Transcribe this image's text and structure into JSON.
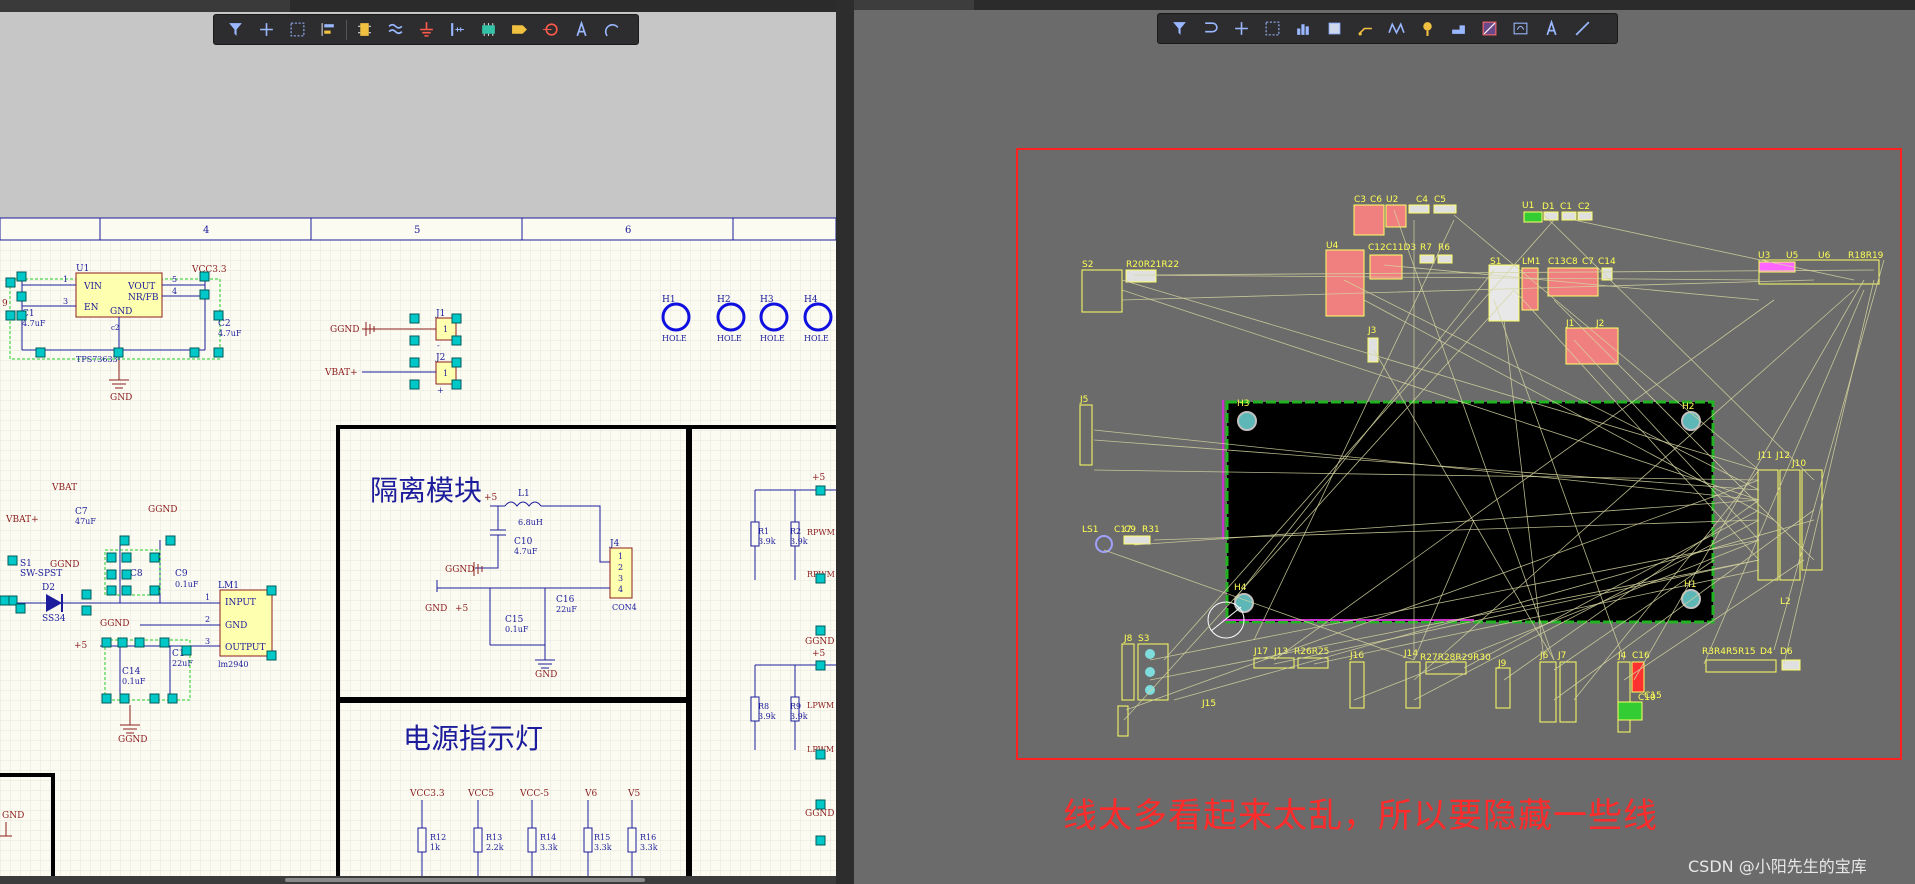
{
  "schematic": {
    "grid_columns": [
      "4",
      "5",
      "6"
    ],
    "power_block": {
      "ic_ref": "U1",
      "ic_part": "TPS73633",
      "pins": [
        "VIN",
        "EN",
        "VOUT",
        "NR/FB",
        "GND"
      ],
      "pin_numbers": [
        "1",
        "3",
        "5",
        "4",
        "c2"
      ],
      "cap1_ref": "C1",
      "cap1_val": "4.7uF",
      "cap2_ref": "C2",
      "cap2_val": "4.7uF",
      "net_vcc": "VCC3.3",
      "net_gnd": "GND",
      "left_fragment": "9"
    },
    "connectors": {
      "j1": "J1",
      "j2": "J2",
      "pin": "1",
      "j1_net": "GGND",
      "j2_net": "VBAT+",
      "minus": "-",
      "plus": "+"
    },
    "holes": [
      {
        "ref": "H1",
        "label": "HOLE"
      },
      {
        "ref": "H2",
        "label": "HOLE"
      },
      {
        "ref": "H3",
        "label": "HOLE"
      },
      {
        "ref": "H4",
        "label": "HOLE"
      }
    ],
    "regulator_block": {
      "vbat": "VBAT",
      "vbat_plus": "VBAT+",
      "switch_ref": "S1",
      "switch_part": "SW-SPST",
      "c7_ref": "C7",
      "c7_val": "47uF",
      "ggnd": "GGND",
      "c8_ref": "C8",
      "c9_ref": "C9",
      "c9_val": "0.1uF",
      "diode_ref": "D2",
      "diode_part": "SS34",
      "lm_ref": "LM1",
      "lm_part": "lm2940",
      "lm_pins": [
        "INPUT",
        "GND",
        "OUTPUT"
      ],
      "lm_pin_numbers": [
        "1",
        "2",
        "3"
      ],
      "c14_ref": "C14",
      "c14_val": "0.1uF",
      "c12_ref": "C1",
      "c12_val": "22uF",
      "plus5": "+5"
    },
    "isolation": {
      "title": "隔离模块",
      "l1_ref": "L1",
      "l1_val": "6.8uH",
      "c10_ref": "C10",
      "c10_val": "4.7uF",
      "c15_ref": "C15",
      "c15_val": "0.1uF",
      "c16_ref": "C16",
      "c16_val": "22uF",
      "j4_ref": "J4",
      "j4_part": "CON4",
      "j4_pins": [
        "1",
        "2",
        "3",
        "4"
      ],
      "gnd": "GND",
      "ggnd": "GGND",
      "plus5": "+5"
    },
    "indicator": {
      "title": "电源指示灯",
      "nets": [
        "VCC3.3",
        "VCC5",
        "VCC-5",
        "V6",
        "V5"
      ],
      "refs": [
        "R12",
        "R13",
        "R14",
        "R15",
        "R16"
      ],
      "vals": [
        "1k",
        "2.2k",
        "3.3k",
        "3.3k",
        "3.3k"
      ]
    },
    "right_partial": {
      "plus5": "+5",
      "r1": "R1",
      "r1v": "3.9k",
      "r2": "R2",
      "r2v": "3.9k",
      "rpwm": "RPWM",
      "rpwm2": "RPWM",
      "r8": "R8",
      "r8v": "3.9k",
      "r9": "R9",
      "r9v": "3.9k",
      "lpwm": "LPWM",
      "lpwm2": "LPWM",
      "ggnd": "GGND"
    },
    "bottom_left_fragment": "GND"
  },
  "pcb": {
    "designators": [
      "C3",
      "C6",
      "U2",
      "C4",
      "C5",
      "U1",
      "D1",
      "C1",
      "C2",
      "S2",
      "R20R21R22",
      "U4",
      "C12C11D3",
      "R7",
      "R6",
      "S1",
      "LM1",
      "C13C8",
      "C7",
      "C14",
      "U3",
      "U5",
      "U6",
      "R18R19",
      "J3",
      "J1",
      "J2",
      "J5",
      "H3",
      "H2",
      "H4",
      "H1",
      "LS1",
      "C17",
      "C9",
      "R31",
      "J11",
      "J12",
      "J10",
      "L2",
      "J8",
      "S3",
      "J17",
      "J13",
      "R26R25",
      "J16",
      "J14",
      "R27R28R29R30",
      "J9",
      "J6",
      "J7",
      "J4",
      "C16",
      "C15",
      "C10",
      "R3R4R5R15",
      "D4",
      "D6",
      "J15"
    ]
  },
  "annotation": "线太多看起来太乱，所以要隐藏一些线",
  "watermark": "CSDN @小阳先生的宝库",
  "icons": {
    "sch_toolbar": [
      "filter-icon",
      "add-icon",
      "select-rect-icon",
      "align-icon",
      "part-icon",
      "harness-icon",
      "gnd-icon",
      "bus-icon",
      "component-icon",
      "netlabel-icon",
      "port-icon",
      "text-icon",
      "arc-icon"
    ],
    "pcb_toolbar": [
      "filter-icon",
      "route-icon",
      "add-icon",
      "select-rect-icon",
      "chart-icon",
      "component-icon",
      "interactive-route-icon",
      "diff-pair-icon",
      "pin-icon",
      "pad-icon",
      "fill-icon",
      "dimension-icon",
      "text-icon",
      "line-icon"
    ]
  },
  "colors": {
    "sheet": "#fbfbf2",
    "wire": "#1c1c9c",
    "label": "#8b1c1c",
    "pad": "#00c8c8",
    "ic_fill": "#ffffb0",
    "annotation": "#ff2a2a",
    "pcb_text": "#ffff55",
    "pcb_board": "#000000",
    "pcb_outline": "#21b321"
  }
}
